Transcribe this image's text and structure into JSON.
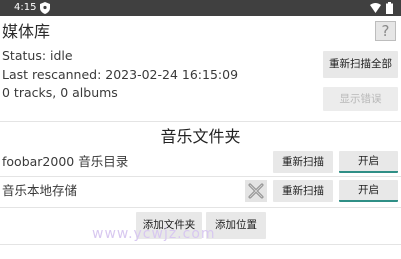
{
  "statusbar": {
    "time": "4:15",
    "icons": [
      "shield-icon",
      "wifi-icon",
      "battery-icon"
    ]
  },
  "header": {
    "title": "媒体库",
    "help_label": "?"
  },
  "info": {
    "status": "Status: idle",
    "last_rescanned": "Last rescanned: 2023-02-24 16:15:09",
    "counts": "0 tracks, 0 albums"
  },
  "actions": {
    "rescan_all_label": "重新扫描全部",
    "show_errors_label": "显示错误"
  },
  "section": {
    "title": "音乐文件夹"
  },
  "folders": [
    {
      "name": "foobar2000 音乐目录",
      "rescan_label": "重新扫描",
      "toggle_label": "开启"
    },
    {
      "name": "音乐本地存储",
      "rescan_label": "重新扫描",
      "toggle_label": "开启"
    }
  ],
  "footer": {
    "add_folder_label": "添加文件夹",
    "add_location_label": "添加位置"
  },
  "watermark": "www.ycwjz.com",
  "colors": {
    "status_bar": "#404040",
    "toggle_accent": "#2f8f86",
    "button_bg": "#e8e8e8"
  }
}
